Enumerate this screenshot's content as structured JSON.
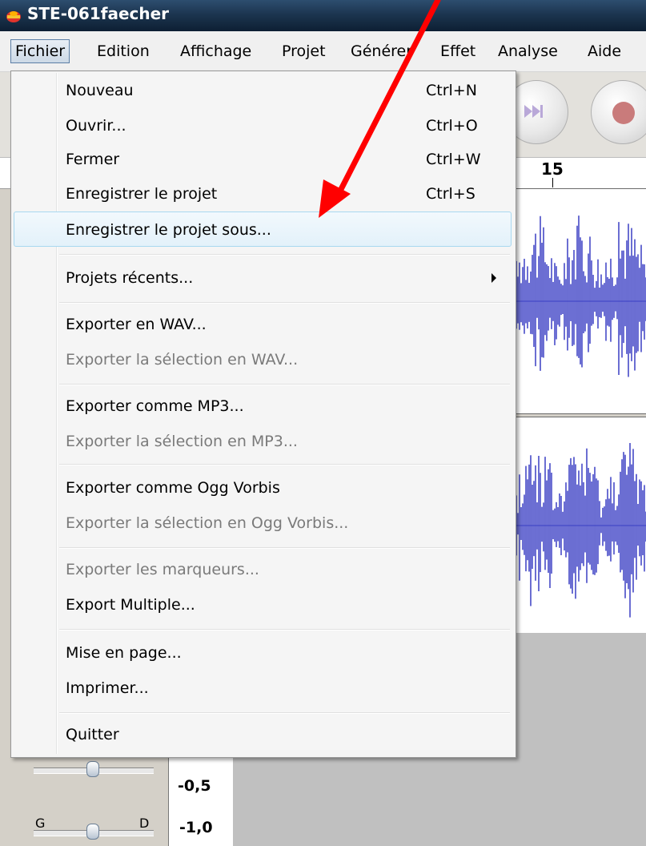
{
  "window": {
    "title": "STE-061faecher"
  },
  "menubar": {
    "items": [
      "Fichier",
      "Edition",
      "Affichage",
      "Projet",
      "Générer",
      "Effet",
      "Analyse",
      "Aide"
    ]
  },
  "ruler": {
    "label": "15"
  },
  "scale": {
    "neg_half": "-0,5",
    "neg_one": "-1,0"
  },
  "pan_slider": {
    "left_label": "G",
    "right_label": "D"
  },
  "file_menu": {
    "items": [
      {
        "label": "Nouveau",
        "shortcut": "Ctrl+N"
      },
      {
        "label": "Ouvrir...",
        "shortcut": "Ctrl+O"
      },
      {
        "label": "Fermer",
        "shortcut": "Ctrl+W"
      },
      {
        "label": "Enregistrer le projet",
        "shortcut": "Ctrl+S"
      },
      {
        "label": "Enregistrer le projet sous...",
        "shortcut": ""
      },
      {
        "label": "Projets récents...",
        "shortcut": ""
      },
      {
        "label": "Exporter en WAV...",
        "shortcut": ""
      },
      {
        "label": "Exporter la sélection en WAV...",
        "shortcut": ""
      },
      {
        "label": "Exporter comme MP3...",
        "shortcut": ""
      },
      {
        "label": "Exporter la sélection en MP3...",
        "shortcut": ""
      },
      {
        "label": "Exporter comme Ogg Vorbis",
        "shortcut": ""
      },
      {
        "label": "Exporter la sélection en Ogg Vorbis...",
        "shortcut": ""
      },
      {
        "label": "Exporter les marqueurs...",
        "shortcut": ""
      },
      {
        "label": "Export Multiple...",
        "shortcut": ""
      },
      {
        "label": "Mise en page...",
        "shortcut": ""
      },
      {
        "label": "Imprimer...",
        "shortcut": ""
      },
      {
        "label": "Quitter",
        "shortcut": ""
      }
    ]
  },
  "colors": {
    "waveform": "#3a3fc4",
    "annotation_arrow": "#ff0000",
    "highlight": "#e3f1fa"
  }
}
